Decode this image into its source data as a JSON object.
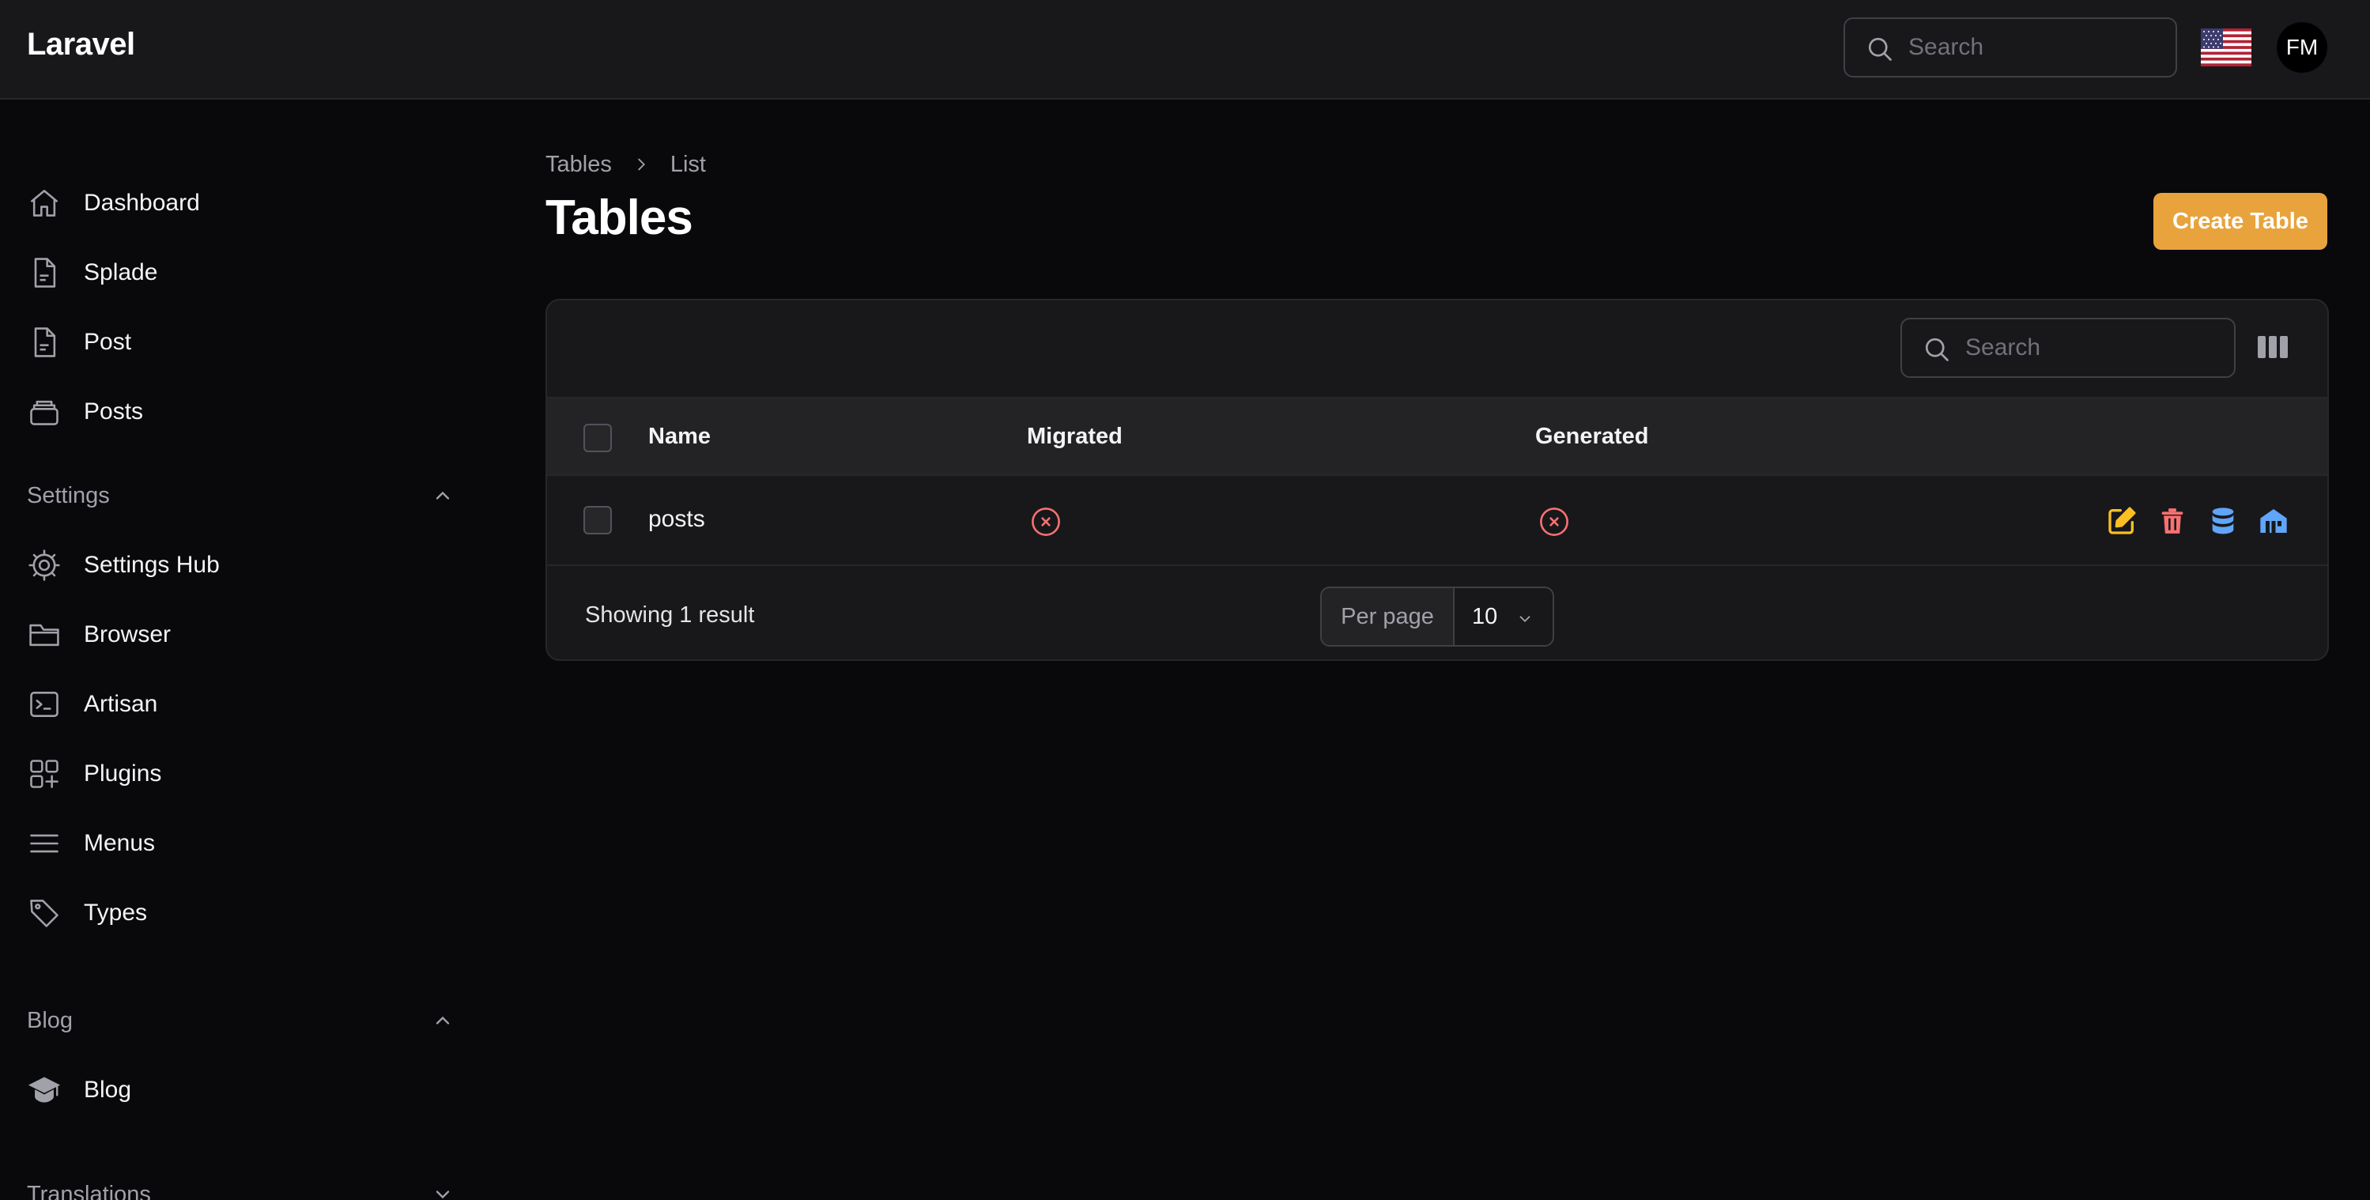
{
  "app": {
    "brand": "Laravel"
  },
  "header": {
    "search_placeholder": "Search",
    "flag_icon": "us-flag-icon",
    "user_initials": "FM"
  },
  "sidebar": {
    "items": [
      {
        "label": "Dashboard",
        "icon": "home-icon"
      },
      {
        "label": "Splade",
        "icon": "document-icon"
      },
      {
        "label": "Post",
        "icon": "document-icon"
      },
      {
        "label": "Posts",
        "icon": "stack-icon"
      }
    ],
    "settings": {
      "title": "Settings",
      "expanded": true,
      "items": [
        {
          "label": "Settings Hub",
          "icon": "cog-icon"
        },
        {
          "label": "Browser",
          "icon": "folder-icon"
        },
        {
          "label": "Artisan",
          "icon": "terminal-icon"
        },
        {
          "label": "Plugins",
          "icon": "squares-plus-icon"
        },
        {
          "label": "Menus",
          "icon": "bars-icon"
        },
        {
          "label": "Types",
          "icon": "tag-icon"
        }
      ]
    },
    "blog": {
      "title": "Blog",
      "expanded": true,
      "items": [
        {
          "label": "Blog",
          "icon": "academic-cap-icon"
        }
      ]
    },
    "translations": {
      "title": "Translations",
      "expanded": false
    }
  },
  "page": {
    "breadcrumb": [
      "Tables",
      "List"
    ],
    "title": "Tables",
    "create_button": "Create Table"
  },
  "table": {
    "search_placeholder": "Search",
    "columns": [
      "Name",
      "Migrated",
      "Generated"
    ],
    "rows": [
      {
        "name": "posts",
        "migrated": false,
        "generated": false
      }
    ],
    "row_actions": [
      "edit-icon",
      "trash-icon",
      "database-icon",
      "building-icon"
    ],
    "footer": {
      "showing": "Showing 1 result",
      "per_page_label": "Per page",
      "per_page_value": "10"
    }
  },
  "colors": {
    "accent": "#e8a33d",
    "danger": "#f87171",
    "edit": "#fbbf24",
    "info": "#60a5fa"
  }
}
